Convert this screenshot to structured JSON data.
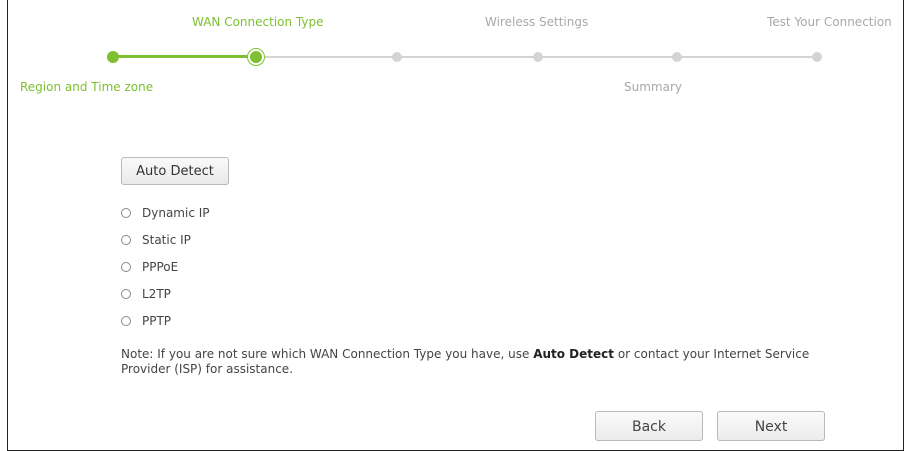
{
  "stepper": {
    "steps_top": [
      {
        "label": "WAN Connection Type",
        "state": "active"
      },
      {
        "label": "Wireless Settings",
        "state": "inactive"
      },
      {
        "label": "Test Your Connection",
        "state": "inactive"
      }
    ],
    "steps_bottom": [
      {
        "label": "Region and Time zone",
        "state": "done"
      },
      {
        "label": "Summary",
        "state": "inactive"
      }
    ]
  },
  "auto_detect": {
    "label": "Auto Detect"
  },
  "connection_types": [
    {
      "label": "Dynamic IP",
      "selected": false
    },
    {
      "label": "Static IP",
      "selected": false
    },
    {
      "label": "PPPoE",
      "selected": false
    },
    {
      "label": "L2TP",
      "selected": false
    },
    {
      "label": "PPTP",
      "selected": false
    }
  ],
  "note": {
    "prefix": "Note: If you are not sure which WAN Connection Type you have, use ",
    "bold": "Auto Detect",
    "suffix": " or contact your Internet Service Provider (ISP) for assistance."
  },
  "buttons": {
    "back": "Back",
    "next": "Next"
  },
  "colors": {
    "accent": "#7ec031",
    "inactive": "#a9a9a9",
    "track": "#d4d4d4"
  }
}
